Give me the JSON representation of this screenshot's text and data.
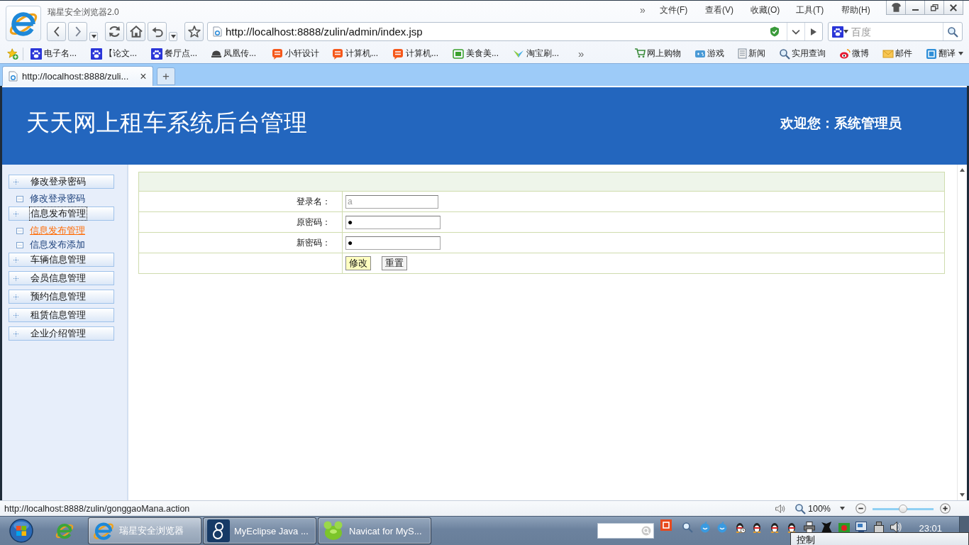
{
  "browser": {
    "title": "瑞星安全浏览器2.0",
    "menu_overflow": "»",
    "menu": [
      "文件(F)",
      "查看(V)",
      "收藏(O)",
      "工具(T)",
      "帮助(H)"
    ],
    "address": "http://localhost:8888/zulin/admin/index.jsp",
    "search_placeholder": "百度"
  },
  "bookmarks": [
    {
      "label": "电子名...",
      "kind": "paw"
    },
    {
      "label": "【论文...",
      "kind": "paw"
    },
    {
      "label": "餐厅点...",
      "kind": "paw"
    },
    {
      "label": "凤凰传...",
      "kind": "dome"
    },
    {
      "label": "小轩设计",
      "kind": "bubble"
    },
    {
      "label": "计算机...",
      "kind": "bubble"
    },
    {
      "label": "计算机...",
      "kind": "bubble"
    },
    {
      "label": "美食美...",
      "kind": "screen"
    },
    {
      "label": "淘宝刷...",
      "kind": "wing"
    }
  ],
  "bookmarks_overflow": "»",
  "quick_links": [
    {
      "label": "网上购物",
      "kind": "cart"
    },
    {
      "label": "游戏",
      "kind": "gamepad"
    },
    {
      "label": "新闻",
      "kind": "news"
    },
    {
      "label": "实用查询",
      "kind": "search"
    },
    {
      "label": "微博",
      "kind": "eye"
    },
    {
      "label": "邮件",
      "kind": "mail"
    },
    {
      "label": "翻译",
      "kind": "tile"
    }
  ],
  "tabs": [
    {
      "label": "http://localhost:8888/zuli...",
      "selected": true,
      "close": "×"
    }
  ],
  "new_tab": "+",
  "header": {
    "title": "天天网上租车系统后台管理",
    "welcome": "欢迎您：系统管理员"
  },
  "sidebar": {
    "groups": [
      {
        "label": "修改登录密码",
        "focused": false,
        "children": [
          {
            "label": "修改登录密码",
            "hovered": false
          }
        ]
      },
      {
        "label": "信息发布管理",
        "focused": true,
        "children": [
          {
            "label": "信息发布管理",
            "hovered": true
          },
          {
            "label": "信息发布添加",
            "hovered": false
          }
        ]
      },
      {
        "label": "车辆信息管理",
        "focused": false
      },
      {
        "label": "会员信息管理",
        "focused": false
      },
      {
        "label": "预约信息管理",
        "focused": false
      },
      {
        "label": "租赁信息管理",
        "focused": false
      },
      {
        "label": "企业介绍管理",
        "focused": false
      }
    ]
  },
  "form": {
    "rows": [
      {
        "label": "登录名：",
        "kind": "text",
        "value": "a",
        "disabled": true
      },
      {
        "label": "原密码：",
        "kind": "password",
        "value": "●",
        "disabled": false
      },
      {
        "label": "新密码：",
        "kind": "password",
        "value": "●",
        "disabled": false
      }
    ],
    "buttons": [
      {
        "label": "修改",
        "kind": "submit"
      },
      {
        "label": "重置",
        "kind": "reset"
      }
    ]
  },
  "status_bar": {
    "url": "http://localhost:8888/zulin/gonggaoMana.action",
    "zoom": "100%",
    "zoom_slider": {
      "level": 0.5
    }
  },
  "taskbar": {
    "tasks": [
      {
        "label": "瑞星安全浏览器",
        "kind": "browser",
        "selected": true
      },
      {
        "label": "MyEclipse Java ...",
        "kind": "eclipse",
        "selected": false
      },
      {
        "label": "Navicat for MyS...",
        "kind": "navicat",
        "selected": false
      }
    ],
    "clock": "23:01",
    "popup": [
      "控制"
    ]
  }
}
